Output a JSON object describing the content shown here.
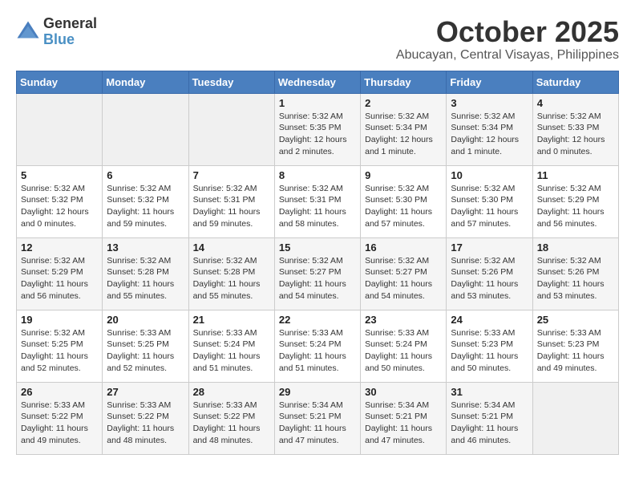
{
  "logo": {
    "general": "General",
    "blue": "Blue"
  },
  "title": "October 2025",
  "location": "Abucayan, Central Visayas, Philippines",
  "weekdays": [
    "Sunday",
    "Monday",
    "Tuesday",
    "Wednesday",
    "Thursday",
    "Friday",
    "Saturday"
  ],
  "weeks": [
    [
      {
        "day": "",
        "info": ""
      },
      {
        "day": "",
        "info": ""
      },
      {
        "day": "",
        "info": ""
      },
      {
        "day": "1",
        "info": "Sunrise: 5:32 AM\nSunset: 5:35 PM\nDaylight: 12 hours\nand 2 minutes."
      },
      {
        "day": "2",
        "info": "Sunrise: 5:32 AM\nSunset: 5:34 PM\nDaylight: 12 hours\nand 1 minute."
      },
      {
        "day": "3",
        "info": "Sunrise: 5:32 AM\nSunset: 5:34 PM\nDaylight: 12 hours\nand 1 minute."
      },
      {
        "day": "4",
        "info": "Sunrise: 5:32 AM\nSunset: 5:33 PM\nDaylight: 12 hours\nand 0 minutes."
      }
    ],
    [
      {
        "day": "5",
        "info": "Sunrise: 5:32 AM\nSunset: 5:32 PM\nDaylight: 12 hours\nand 0 minutes."
      },
      {
        "day": "6",
        "info": "Sunrise: 5:32 AM\nSunset: 5:32 PM\nDaylight: 11 hours\nand 59 minutes."
      },
      {
        "day": "7",
        "info": "Sunrise: 5:32 AM\nSunset: 5:31 PM\nDaylight: 11 hours\nand 59 minutes."
      },
      {
        "day": "8",
        "info": "Sunrise: 5:32 AM\nSunset: 5:31 PM\nDaylight: 11 hours\nand 58 minutes."
      },
      {
        "day": "9",
        "info": "Sunrise: 5:32 AM\nSunset: 5:30 PM\nDaylight: 11 hours\nand 57 minutes."
      },
      {
        "day": "10",
        "info": "Sunrise: 5:32 AM\nSunset: 5:30 PM\nDaylight: 11 hours\nand 57 minutes."
      },
      {
        "day": "11",
        "info": "Sunrise: 5:32 AM\nSunset: 5:29 PM\nDaylight: 11 hours\nand 56 minutes."
      }
    ],
    [
      {
        "day": "12",
        "info": "Sunrise: 5:32 AM\nSunset: 5:29 PM\nDaylight: 11 hours\nand 56 minutes."
      },
      {
        "day": "13",
        "info": "Sunrise: 5:32 AM\nSunset: 5:28 PM\nDaylight: 11 hours\nand 55 minutes."
      },
      {
        "day": "14",
        "info": "Sunrise: 5:32 AM\nSunset: 5:28 PM\nDaylight: 11 hours\nand 55 minutes."
      },
      {
        "day": "15",
        "info": "Sunrise: 5:32 AM\nSunset: 5:27 PM\nDaylight: 11 hours\nand 54 minutes."
      },
      {
        "day": "16",
        "info": "Sunrise: 5:32 AM\nSunset: 5:27 PM\nDaylight: 11 hours\nand 54 minutes."
      },
      {
        "day": "17",
        "info": "Sunrise: 5:32 AM\nSunset: 5:26 PM\nDaylight: 11 hours\nand 53 minutes."
      },
      {
        "day": "18",
        "info": "Sunrise: 5:32 AM\nSunset: 5:26 PM\nDaylight: 11 hours\nand 53 minutes."
      }
    ],
    [
      {
        "day": "19",
        "info": "Sunrise: 5:32 AM\nSunset: 5:25 PM\nDaylight: 11 hours\nand 52 minutes."
      },
      {
        "day": "20",
        "info": "Sunrise: 5:33 AM\nSunset: 5:25 PM\nDaylight: 11 hours\nand 52 minutes."
      },
      {
        "day": "21",
        "info": "Sunrise: 5:33 AM\nSunset: 5:24 PM\nDaylight: 11 hours\nand 51 minutes."
      },
      {
        "day": "22",
        "info": "Sunrise: 5:33 AM\nSunset: 5:24 PM\nDaylight: 11 hours\nand 51 minutes."
      },
      {
        "day": "23",
        "info": "Sunrise: 5:33 AM\nSunset: 5:24 PM\nDaylight: 11 hours\nand 50 minutes."
      },
      {
        "day": "24",
        "info": "Sunrise: 5:33 AM\nSunset: 5:23 PM\nDaylight: 11 hours\nand 50 minutes."
      },
      {
        "day": "25",
        "info": "Sunrise: 5:33 AM\nSunset: 5:23 PM\nDaylight: 11 hours\nand 49 minutes."
      }
    ],
    [
      {
        "day": "26",
        "info": "Sunrise: 5:33 AM\nSunset: 5:22 PM\nDaylight: 11 hours\nand 49 minutes."
      },
      {
        "day": "27",
        "info": "Sunrise: 5:33 AM\nSunset: 5:22 PM\nDaylight: 11 hours\nand 48 minutes."
      },
      {
        "day": "28",
        "info": "Sunrise: 5:33 AM\nSunset: 5:22 PM\nDaylight: 11 hours\nand 48 minutes."
      },
      {
        "day": "29",
        "info": "Sunrise: 5:34 AM\nSunset: 5:21 PM\nDaylight: 11 hours\nand 47 minutes."
      },
      {
        "day": "30",
        "info": "Sunrise: 5:34 AM\nSunset: 5:21 PM\nDaylight: 11 hours\nand 47 minutes."
      },
      {
        "day": "31",
        "info": "Sunrise: 5:34 AM\nSunset: 5:21 PM\nDaylight: 11 hours\nand 46 minutes."
      },
      {
        "day": "",
        "info": ""
      }
    ]
  ]
}
